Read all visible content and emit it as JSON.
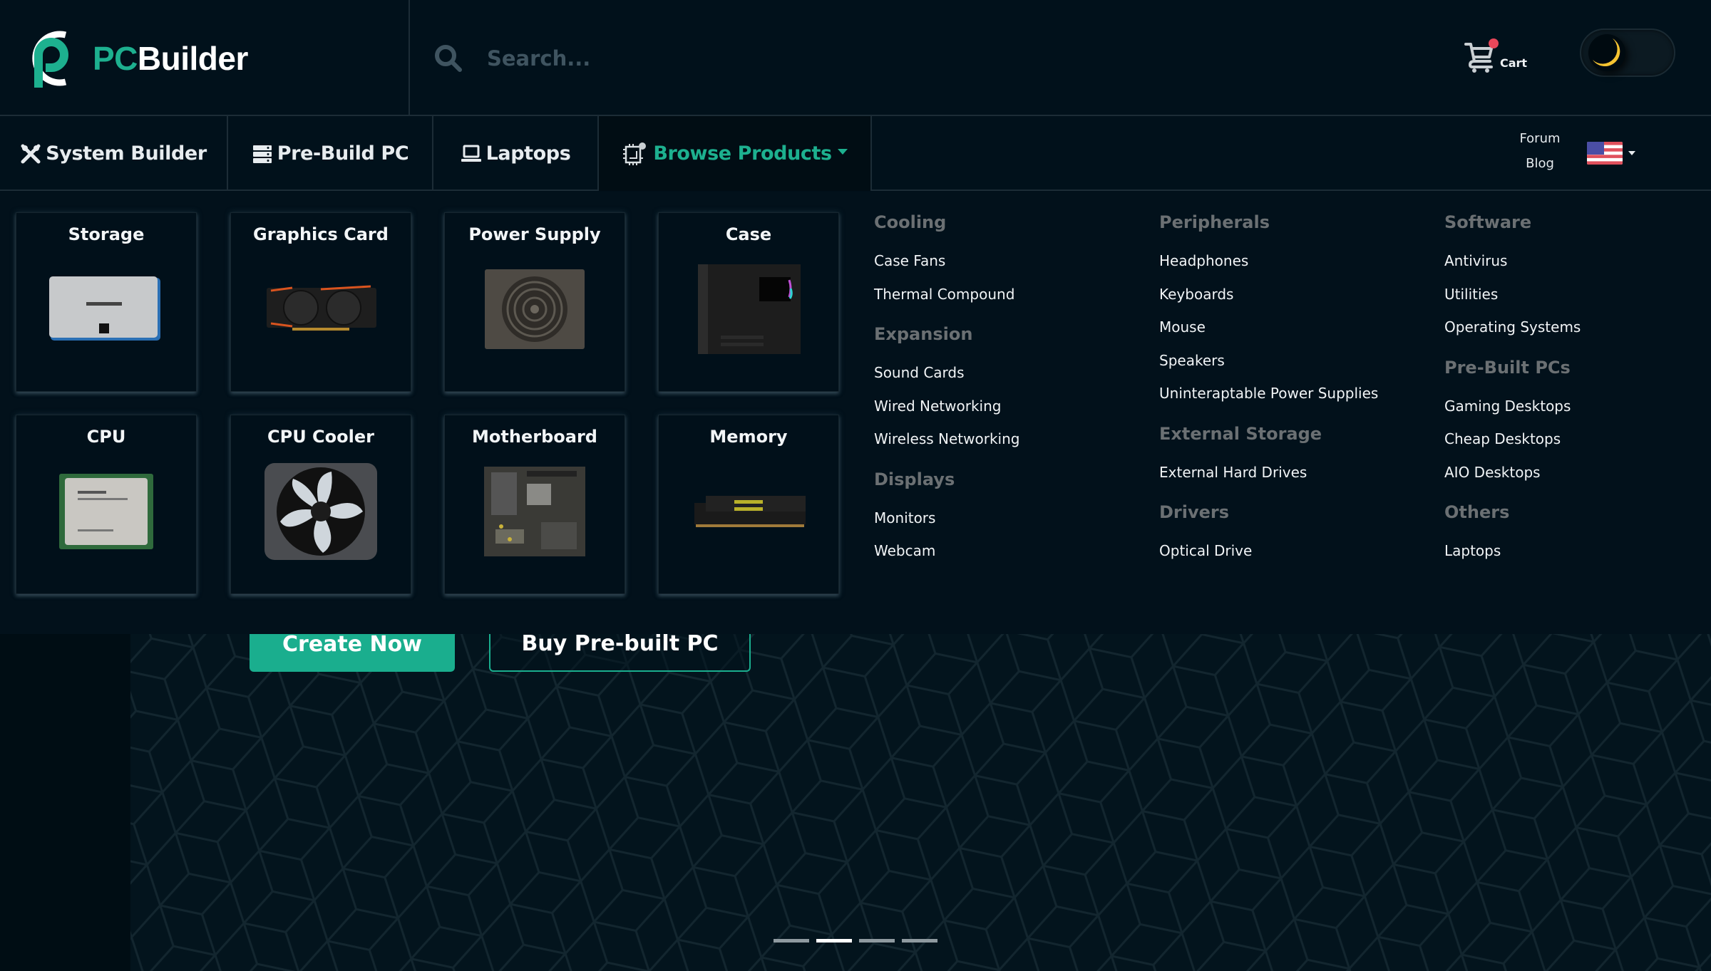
{
  "brand": {
    "name_part1": "PC",
    "name_part2": "Builder",
    "accent_color": "#1db08f"
  },
  "search": {
    "placeholder": "Search...",
    "value": ""
  },
  "header": {
    "cart_label": "Cart",
    "cart_has_badge": true,
    "theme_toggle": "dark"
  },
  "nav": {
    "items": [
      {
        "label": "System Builder",
        "icon": "tools-icon"
      },
      {
        "label": "Pre-Build PC",
        "icon": "server-icon"
      },
      {
        "label": "Laptops",
        "icon": "laptop-icon"
      },
      {
        "label": "Browse Products",
        "icon": "cpu-chip-icon",
        "active": true,
        "has_dropdown": true
      }
    ],
    "right_links": [
      "Forum",
      "Blog"
    ],
    "language": "en-US"
  },
  "dropdown": {
    "cards": [
      {
        "label": "Storage",
        "image": "ssd"
      },
      {
        "label": "Graphics Card",
        "image": "gpu"
      },
      {
        "label": "Power Supply",
        "image": "psu"
      },
      {
        "label": "Case",
        "image": "case"
      },
      {
        "label": "CPU",
        "image": "cpu"
      },
      {
        "label": "CPU Cooler",
        "image": "fan"
      },
      {
        "label": "Motherboard",
        "image": "motherboard"
      },
      {
        "label": "Memory",
        "image": "ram"
      }
    ],
    "columns": [
      [
        {
          "heading": "Cooling",
          "links": [
            "Case Fans",
            "Thermal Compound"
          ]
        },
        {
          "heading": "Expansion",
          "links": [
            "Sound Cards",
            "Wired Networking",
            "Wireless Networking"
          ]
        },
        {
          "heading": "Displays",
          "links": [
            "Monitors",
            "Webcam"
          ]
        }
      ],
      [
        {
          "heading": "Peripherals",
          "links": [
            "Headphones",
            "Keyboards",
            "Mouse",
            "Speakers",
            "Uninteraptable Power Supplies"
          ]
        },
        {
          "heading": "External Storage",
          "links": [
            "External Hard Drives"
          ]
        },
        {
          "heading": "Drivers",
          "links": [
            "Optical Drive"
          ]
        }
      ],
      [
        {
          "heading": "Software",
          "links": [
            "Antivirus",
            "Utilities",
            "Operating Systems"
          ]
        },
        {
          "heading": "Pre-Built PCs",
          "links": [
            "Gaming Desktops",
            "Cheap Desktops",
            "AIO Desktops"
          ]
        },
        {
          "heading": "Others",
          "links": [
            "Laptops"
          ]
        }
      ]
    ]
  },
  "hero": {
    "primary_button": "Create Now",
    "secondary_button": "Buy Pre-built PC",
    "carousel": {
      "total": 4,
      "active_index": 1
    }
  }
}
